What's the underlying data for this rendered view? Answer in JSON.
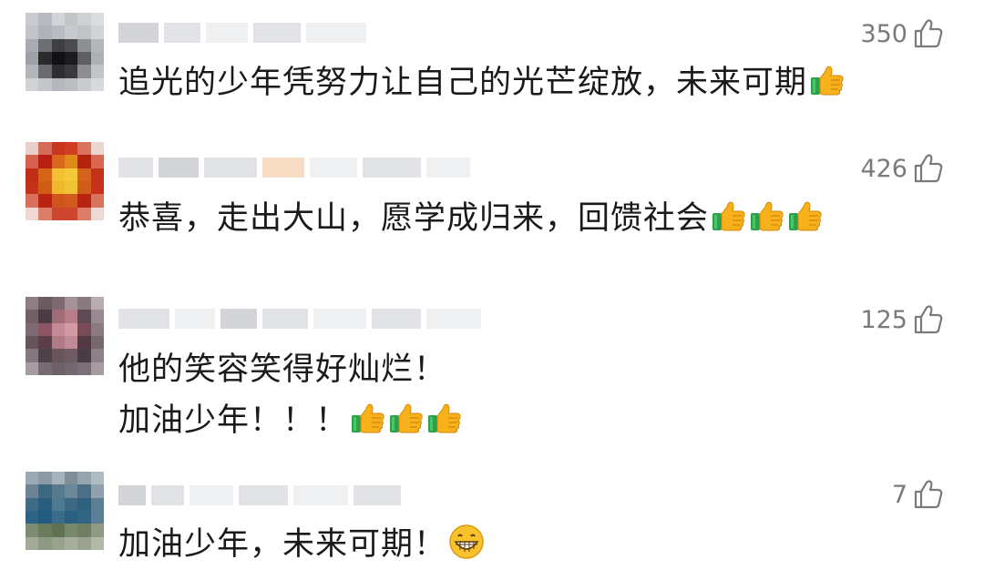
{
  "comments": [
    {
      "likes": "350",
      "lines": [
        "追光的少年凭努力让自己的光芒绽放，未来可期"
      ],
      "emoji": "thumbs-up-icon",
      "emoji_count": 1
    },
    {
      "likes": "426",
      "lines": [
        "恭喜，走出大山，愿学成归来，回馈社会"
      ],
      "emoji": "thumbs-up-icon",
      "emoji_count": 3
    },
    {
      "likes": "125",
      "lines": [
        "他的笑容笑得好灿烂！",
        "加油少年！！！"
      ],
      "emoji": "thumbs-up-icon",
      "emoji_count": 3
    },
    {
      "likes": "7",
      "lines": [
        "加油少年，未来可期！"
      ],
      "emoji": "grin-icon",
      "emoji_count": 1
    }
  ],
  "colors": {
    "like_text": "#7a7a7a",
    "comment_text": "#1a1a1a"
  }
}
